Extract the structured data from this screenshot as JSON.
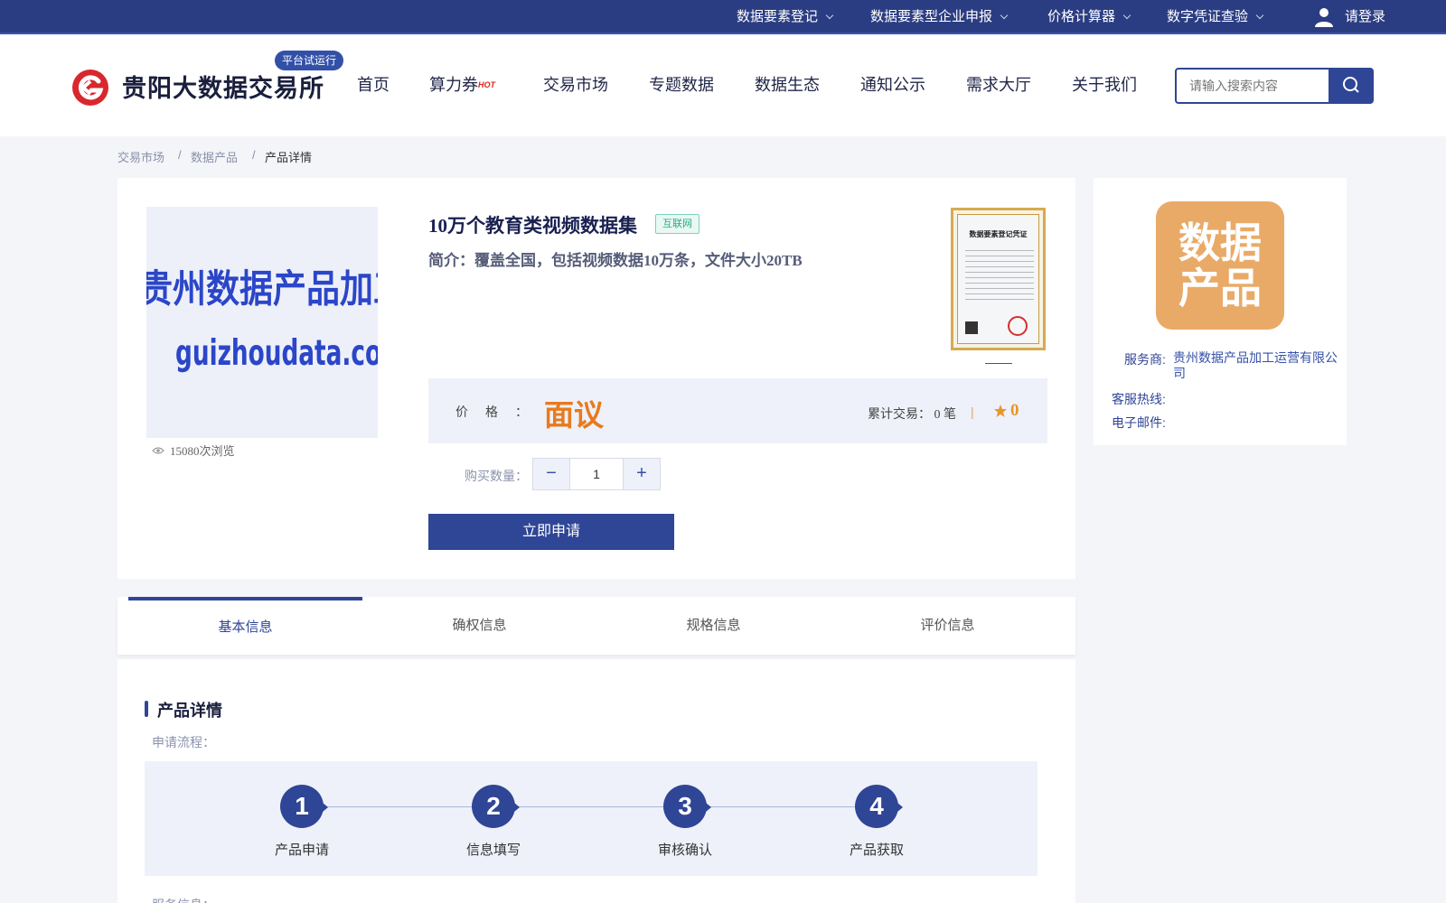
{
  "topbar": {
    "items": [
      "数据要素登记",
      "数据要素型企业申报",
      "价格计算器",
      "数字凭证查验"
    ],
    "login": "请登录"
  },
  "header": {
    "logo_title": "贵阳大数据交易所",
    "trial_badge": "平台试运行",
    "nav": [
      "首页",
      "算力券",
      "交易市场",
      "专题数据",
      "数据生态",
      "通知公示",
      "需求大厅",
      "关于我们"
    ],
    "hot_badge": "HOT",
    "search_placeholder": "请输入搜索内容"
  },
  "breadcrumb": [
    "交易市场",
    "数据产品",
    "产品详情"
  ],
  "breadcrumb_sep": "/",
  "product": {
    "image_line1": "贵州数据产品加工运营有限公司",
    "image_line2": "guizhoudata.com",
    "views": "15080次浏览",
    "title": "10万个教育类视频数据集",
    "tag": "互联网",
    "desc": "简介：覆盖全国，包括视频数据10万条，文件大小20TB",
    "cert_title": "数据要素登记凭证",
    "price_label": "价格：",
    "price_value": "面议",
    "trade_count": "累计交易： 0 笔",
    "sep": "|",
    "score": "0",
    "qty_label": "购买数量：",
    "qty_minus": "−",
    "qty_value": "1",
    "qty_plus": "+",
    "apply_button": "立即申请"
  },
  "side": {
    "logo_text_1": "数据",
    "logo_text_2": "产品",
    "provider_label": "服务商:",
    "provider_value": "贵州数据产品加工运营有限公司",
    "hotline_label": "客服热线:",
    "email_label": "电子邮件:"
  },
  "tabs": [
    "基本信息",
    "确权信息",
    "规格信息",
    "评价信息"
  ],
  "detail": {
    "section_title": "产品详情",
    "process_label": "申请流程：",
    "steps": [
      {
        "num": "1",
        "label": "产品申请"
      },
      {
        "num": "2",
        "label": "信息填写"
      },
      {
        "num": "3",
        "label": "审核确认"
      },
      {
        "num": "4",
        "label": "产品获取"
      }
    ],
    "service_label": "服务信息："
  },
  "colors": {
    "brand": "#2f4596",
    "topbar": "#2b3d82",
    "price": "#e87a1e",
    "side_logo": "#e9aa68",
    "logo_red": "#d9272e"
  }
}
